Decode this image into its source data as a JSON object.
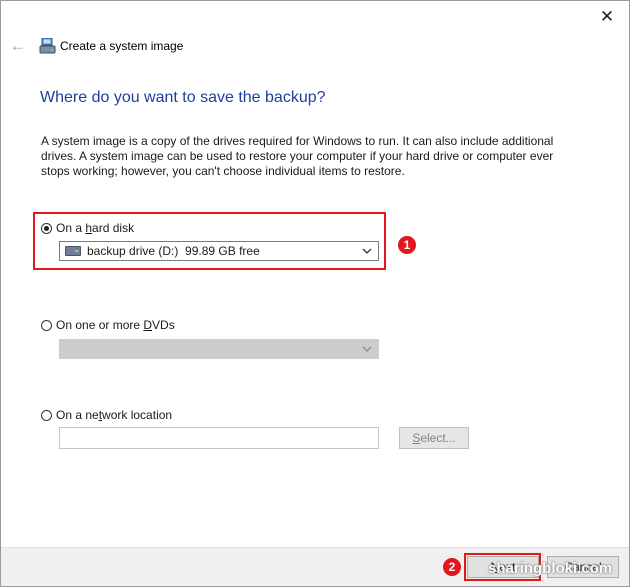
{
  "window": {
    "title": "Create a system image",
    "close_glyph": "✕",
    "back_glyph": "←"
  },
  "heading": "Where do you want to save the backup?",
  "description": "A system image is a copy of the drives required for Windows to run. It can also include additional drives. A system image can be used to restore your computer if your hard drive or computer ever stops working; however, you can't choose individual items to restore.",
  "options": {
    "hard_disk": {
      "label_pre": "On a ",
      "label_accel": "h",
      "label_post": "ard disk",
      "selected": true,
      "dropdown_value": "backup drive (D:)  99.89 GB free"
    },
    "dvds": {
      "label_pre": "On one or more ",
      "label_accel": "D",
      "label_post": "VDs",
      "selected": false,
      "dropdown_value": ""
    },
    "network": {
      "label_pre": "On a ne",
      "label_accel": "t",
      "label_post": "work location",
      "selected": false,
      "input_value": "",
      "select_button_pre": "",
      "select_button_accel": "S",
      "select_button_post": "elect..."
    }
  },
  "buttons": {
    "next_pre": "",
    "next_accel": "N",
    "next_post": "ext",
    "cancel": "Cancel"
  },
  "annotations": {
    "marker_1": "1",
    "marker_2": "2",
    "color": "#e3161b"
  },
  "watermark": "sharingbloki.com",
  "icons": [
    "back-arrow-icon",
    "system-image-icon",
    "close-icon",
    "drive-icon",
    "chevron-down-icon"
  ]
}
